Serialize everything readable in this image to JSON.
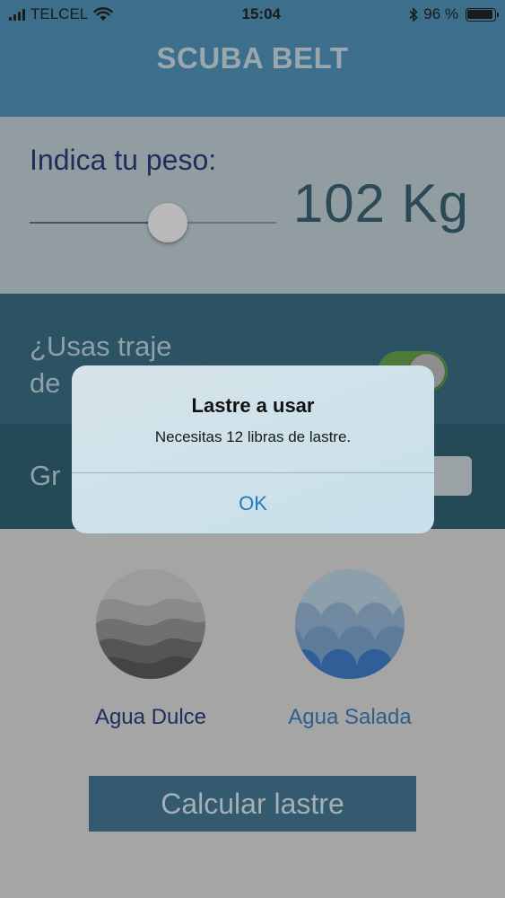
{
  "status_bar": {
    "carrier": "TELCEL",
    "time": "15:04",
    "battery_text": "96 %",
    "battery_level": 0.96,
    "icons": [
      "signal-icon",
      "wifi-icon",
      "bluetooth-icon",
      "battery-icon"
    ]
  },
  "nav": {
    "title": "SCUBA BELT"
  },
  "weight": {
    "label": "Indica tu peso:",
    "value": "102 Kg",
    "slider_level": 0.56
  },
  "wetsuit": {
    "label": "¿Usas traje de",
    "toggle_on": true
  },
  "group": {
    "label": "Gr"
  },
  "water": {
    "fresh_label": "Agua Dulce",
    "salt_label": "Agua Salada"
  },
  "calculate_button": {
    "label": "Calcular lastre"
  },
  "alert": {
    "title": "Lastre a usar",
    "message": "Necesitas 12 libras de lastre.",
    "ok_label": "OK"
  },
  "colors": {
    "nav_bg": "#3d6f8c",
    "alert_ok": "#2a76c6",
    "toggle_on": "#4c7a39",
    "button_bg": "#335a6e"
  }
}
